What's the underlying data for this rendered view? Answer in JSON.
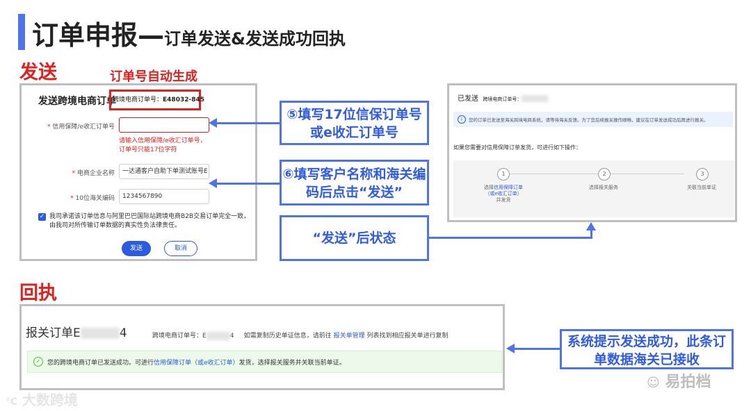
{
  "header": {
    "title_main": "订单申报",
    "title_dash": "—",
    "title_sub": "订单发送&发送成功回执"
  },
  "sections": {
    "send": "发送",
    "receipt": "回执"
  },
  "notes": {
    "order_auto": "订单号自动生成"
  },
  "form": {
    "title": "发送跨境电商订单",
    "order_no_label": "跨境电商订单号：",
    "order_no_value": "E48032-845",
    "field1_label": "信用保障/e收汇订单号",
    "field1_error": "请输入信用保障/e收汇订单号，订单号只能17位字符",
    "field2_label": "电商企业名称",
    "field2_value": "一达通客户自助下单测试账号E",
    "field3_label": "10位海关编码",
    "field3_value": "1234567890",
    "agree_text": "我司承诺该订单信息与阿里巴巴国际站跨境电商B2B交易订单完全一致，由我司对所传输订单数据的真实性负法律责任。",
    "send_button": "发送",
    "cancel_button": "取消"
  },
  "callouts": {
    "c5": "⑤填写17位信保订单号或e收汇订单号",
    "c6": "⑥填写客户名称和海关编码后点击“发送”",
    "after_send": "“发送”后状态",
    "success": "系统提示发送成功，此条订单数据海关已接收"
  },
  "sent_panel": {
    "status": "已发送",
    "order_no_label": "跨境电商订单号：",
    "info": "您的订单已发送至海关跨境电商系统，请等待海关反馈。为了您后续报关操作顺畅，建议在订单发送成功后再进行报关。",
    "prompt": "如果您需要对信用保障订单发货，可进行如下操作：",
    "steps": [
      {
        "num": "1",
        "label_a": "选择",
        "label_link": "信用保障订单",
        "label_b": "（或e收汇订单）",
        "label_c": "并发货"
      },
      {
        "num": "2",
        "label": "选择报关服务"
      },
      {
        "num": "3",
        "label": "关联当前单证"
      }
    ]
  },
  "receipt_panel": {
    "title_prefix": "报关订单E",
    "title_suffix": "4",
    "order_label": "跨境电商订单号：E",
    "order_suffix": "4",
    "copy_text_a": "如需复制历史单证信息，请前往",
    "copy_link": "报关单管理",
    "copy_text_b": "列表找到相应报关单进行复制",
    "success_a": "您的跨境电商订单已发送成功。可进行",
    "success_link": "信用保障订单（或e收汇订单）",
    "success_b": "发货，选择报关服务并关联当前单证。"
  },
  "watermarks": {
    "left": "大数跨境",
    "right": "易拍档"
  },
  "colors": {
    "accent_blue": "#4f73ea",
    "link_blue": "#2b5be0",
    "red": "#e0201c"
  }
}
